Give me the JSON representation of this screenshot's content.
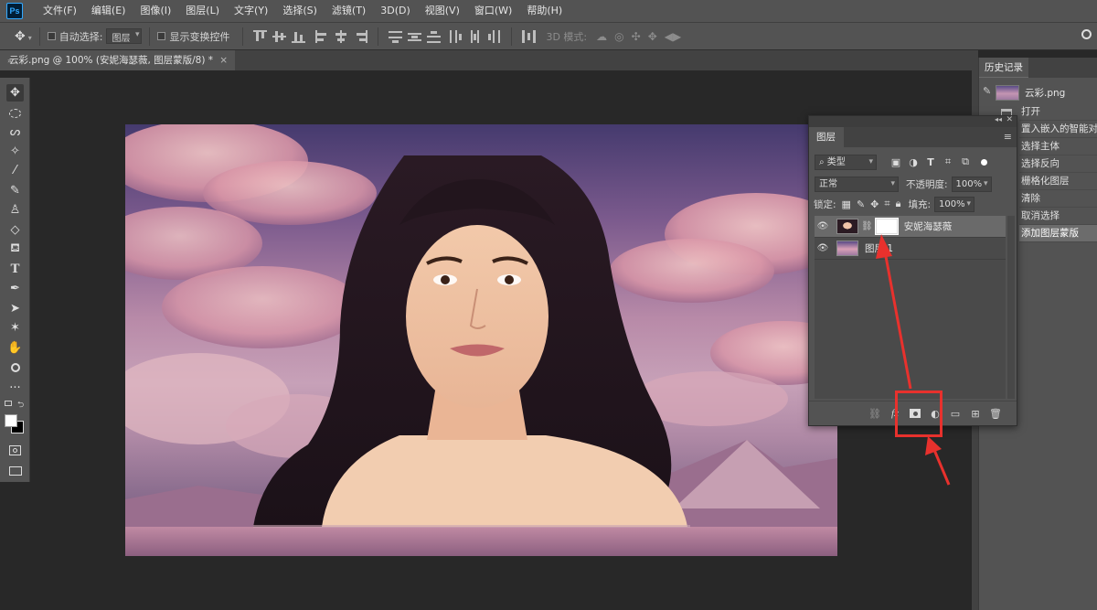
{
  "menubar": {
    "logo": "Ps",
    "items": [
      "文件(F)",
      "编辑(E)",
      "图像(I)",
      "图层(L)",
      "文字(Y)",
      "选择(S)",
      "滤镜(T)",
      "3D(D)",
      "视图(V)",
      "窗口(W)",
      "帮助(H)"
    ]
  },
  "options": {
    "auto_select_label": "自动选择:",
    "auto_select_target": "图层",
    "show_transform_label": "显示变换控件",
    "mode_3d_label": "3D 模式:"
  },
  "document": {
    "tab_title": "云彩.png @ 100% (安妮海瑟薇, 图层蒙版/8) *",
    "close_glyph": "×"
  },
  "history": {
    "tab_label": "历史记录",
    "source_name": "云彩.png",
    "items": [
      "打开",
      "置入嵌入的智能对象",
      "选择主体",
      "选择反向",
      "栅格化图层",
      "清除",
      "取消选择",
      "添加图层蒙版"
    ],
    "active_index": 7
  },
  "layers": {
    "tab_label": "图层",
    "filter_kind": "类型",
    "blend_mode": "正常",
    "opacity_label": "不透明度:",
    "opacity_value": "100%",
    "lock_label": "锁定:",
    "fill_label": "填充:",
    "fill_value": "100%",
    "list": [
      {
        "name": "安妮海瑟薇",
        "selected": true,
        "has_mask": true
      },
      {
        "name": "图层 1",
        "selected": false,
        "has_mask": false
      }
    ]
  },
  "colors": {
    "annotation_red": "#e8312d",
    "ps_blue": "#31a8ff"
  }
}
